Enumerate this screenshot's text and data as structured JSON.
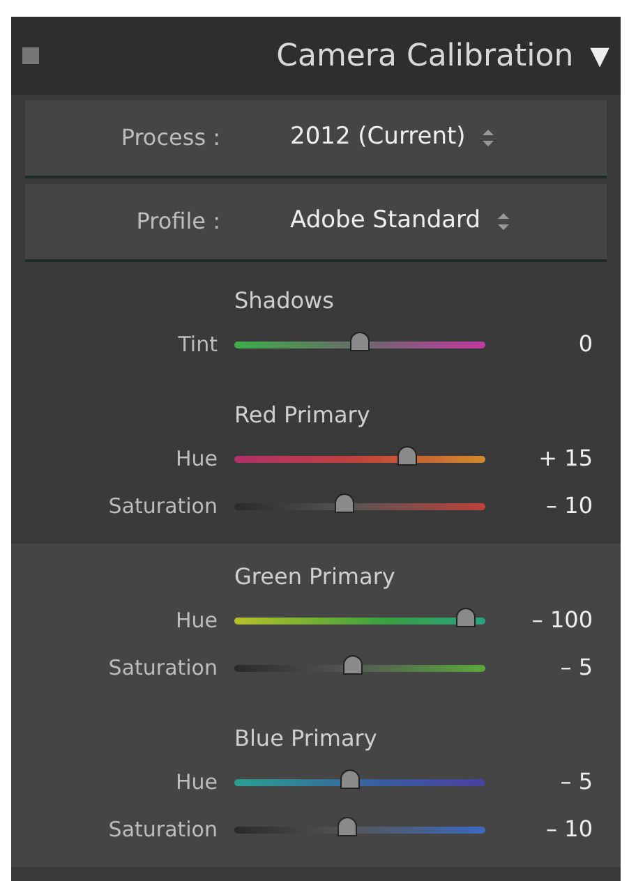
{
  "panel": {
    "title": "Camera Calibration",
    "collapse_glyph": "▼",
    "expanded": true
  },
  "dropdowns": [
    {
      "label": "Process :",
      "value": "2012 (Current)"
    },
    {
      "label": "Profile :",
      "value": "Adobe Standard"
    }
  ],
  "sections": [
    {
      "title": "Shadows",
      "kind": "shadows",
      "sliders": [
        {
          "label": "Tint",
          "kind": "tint",
          "level": 0.5,
          "reading": "0"
        }
      ]
    },
    {
      "title": "Red Primary",
      "kind": "red",
      "sliders": [
        {
          "label": "Hue",
          "kind": "hue",
          "level": 0.69,
          "reading": "+ 15"
        },
        {
          "label": "Saturation",
          "kind": "saturation",
          "level": 0.44,
          "reading": "– 10"
        }
      ]
    },
    {
      "title": "Green Primary",
      "kind": "green",
      "sliders": [
        {
          "label": "Hue",
          "kind": "hue",
          "level": 0.92,
          "reading": "– 100"
        },
        {
          "label": "Saturation",
          "kind": "saturation",
          "level": 0.47,
          "reading": "– 5"
        }
      ]
    },
    {
      "title": "Blue Primary",
      "kind": "blue",
      "sliders": [
        {
          "label": "Hue",
          "kind": "hue",
          "level": 0.46,
          "reading": "– 5"
        },
        {
          "label": "Saturation",
          "kind": "saturation",
          "level": 0.45,
          "reading": "– 10"
        }
      ]
    }
  ]
}
